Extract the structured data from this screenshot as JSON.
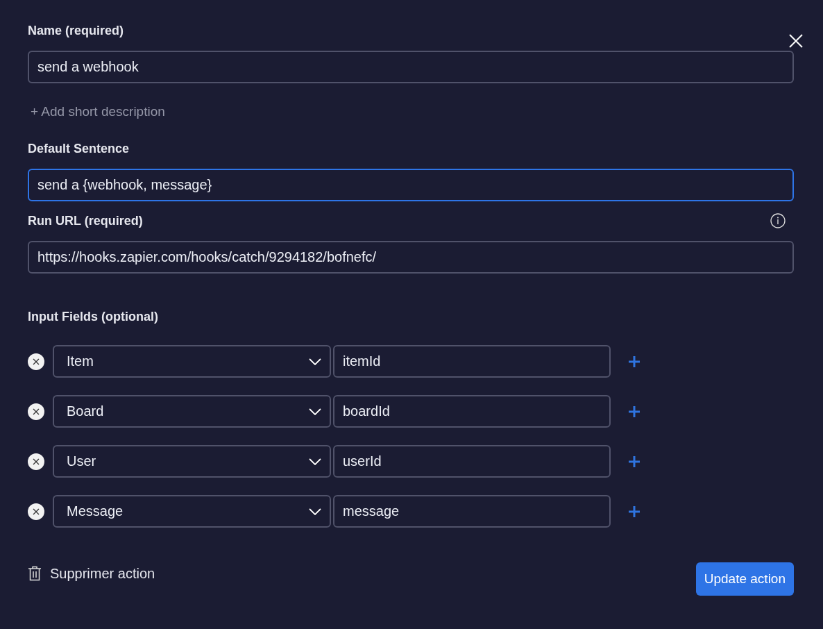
{
  "name_field": {
    "label": "Name (required)",
    "value": "send a webhook",
    "focused": false
  },
  "add_description": "+ Add short description",
  "sentence_field": {
    "label": "Default Sentence",
    "value": "send a {webhook, message}",
    "focused": true
  },
  "run_url_field": {
    "label": "Run URL (required)",
    "value": "https://hooks.zapier.com/hooks/catch/9294182/bofnefc/",
    "focused": false
  },
  "input_fields": {
    "label": "Input Fields (optional)",
    "rows": [
      {
        "type": "Item",
        "key": "itemId"
      },
      {
        "type": "Board",
        "key": "boardId"
      },
      {
        "type": "User",
        "key": "userId"
      },
      {
        "type": "Message",
        "key": "message"
      }
    ]
  },
  "delete_action": "Supprimer action",
  "update_button": "Update action"
}
